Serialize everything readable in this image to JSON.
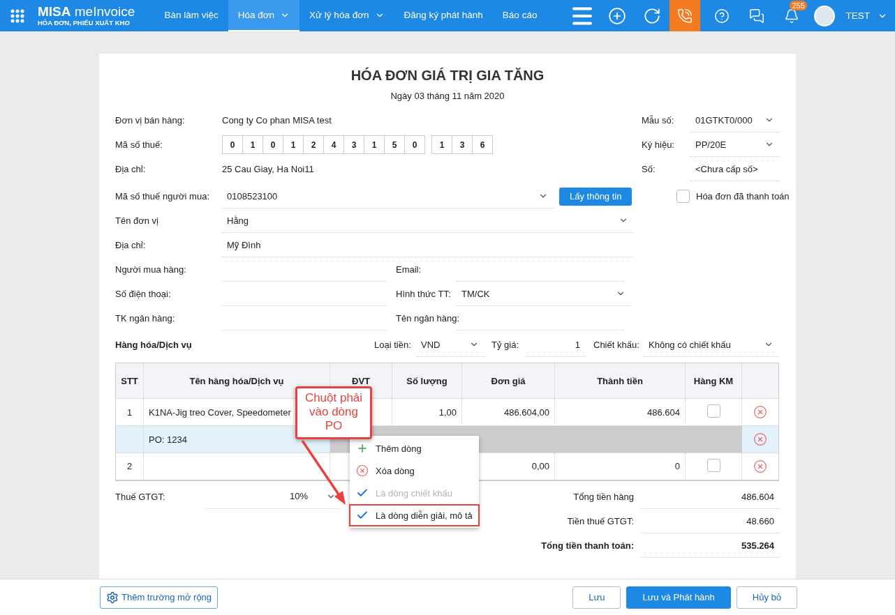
{
  "topbar": {
    "logo": {
      "brand": "MISA",
      "product": "meInvoice",
      "subtitle": "HÓA ĐƠN, PHIẾU XUẤT KHO"
    },
    "nav": [
      {
        "label": "Bàn làm việc",
        "selected": false,
        "dropdown": false
      },
      {
        "label": "Hóa đơn",
        "selected": true,
        "dropdown": true
      },
      {
        "label": "Xử lý hóa đơn",
        "selected": false,
        "dropdown": true
      },
      {
        "label": "Đăng ký phát hành",
        "selected": false,
        "dropdown": false
      },
      {
        "label": "Báo cáo",
        "selected": false,
        "dropdown": false
      }
    ],
    "tools": [
      {
        "kind": "menu",
        "highlighted": false
      },
      {
        "kind": "add",
        "highlighted": false
      },
      {
        "kind": "refresh",
        "highlighted": false
      },
      {
        "kind": "phone",
        "highlighted": true
      },
      {
        "kind": "help",
        "highlighted": false
      },
      {
        "kind": "chat",
        "highlighted": false
      },
      {
        "kind": "bell",
        "highlighted": false,
        "badge": "255"
      }
    ],
    "user": {
      "name": "TEST"
    }
  },
  "invoice": {
    "title": "HÓA ĐƠN GIÁ TRỊ GIA TĂNG",
    "date": "Ngày 03 tháng 11 năm 2020",
    "seller": [
      {
        "kind": "text",
        "label": "Đơn vị bán hàng:",
        "value": "Cong ty Co phan MISA test"
      },
      {
        "kind": "taxcode",
        "label": "Mã số thuế:",
        "groups": [
          [
            "0",
            "1",
            "0",
            "1",
            "2",
            "4",
            "3",
            "1",
            "5",
            "0"
          ],
          [
            "1",
            "3",
            "6"
          ]
        ]
      },
      {
        "kind": "text",
        "label": "Địa chỉ:",
        "value": "25 Cau Giay, Ha Noi11"
      }
    ],
    "meta": [
      {
        "label": "Mẫu số:",
        "value": "01GTKT0/000",
        "dropdown": true
      },
      {
        "label": "Ký hiệu:",
        "value": "PP/20E",
        "dropdown": true
      },
      {
        "label": "Số:",
        "value": "<Chưa cấp số>",
        "dropdown": false
      }
    ],
    "paid": {
      "label": "Hóa đơn đã thanh toán",
      "checked": false
    },
    "buyer": {
      "tax_code": {
        "label": "Mã số thuế người mua:",
        "value": "0108523100"
      },
      "lookup_button": "Lấy thông tin",
      "unit": {
        "label": "Tên đơn vị",
        "value": "Hằng"
      },
      "address": {
        "label": "Địa chỉ:",
        "value": "Mỹ Đình"
      },
      "buyer_name": {
        "label": "Người mua hàng:"
      },
      "email": {
        "label": "Email:"
      },
      "phone": {
        "label": "Số điện thoại:"
      },
      "payment": {
        "label": "Hình thức TT:",
        "value": "TM/CK"
      },
      "bank_account": {
        "label": "TK ngân hàng:"
      },
      "bank_name": {
        "label": "Tên ngân hàng:"
      }
    },
    "goods": {
      "title": "Hàng hóa/Dịch vụ",
      "currency": {
        "label": "Loại tiền:",
        "value": "VND"
      },
      "rate": {
        "label": "Tỷ giá:",
        "value": "1"
      },
      "discount": {
        "label": "Chiết khấu:",
        "value": "Không có chiết khấu"
      }
    },
    "table": {
      "columns": [
        "STT",
        "Tên hàng hóa/Dịch vụ",
        "ĐVT",
        "Số lượng",
        "Đơn giá",
        "Thành tiền",
        "Hàng KM"
      ],
      "rows": [
        {
          "kind": "item",
          "stt": "1",
          "name": "K1NA-Jig treo Cover, Speedometer",
          "quantity": "1,00",
          "unit_price": "486.604,00",
          "amount": "486.604",
          "promo": false,
          "selected": false
        },
        {
          "kind": "note",
          "name": "PO: 1234",
          "selected": true
        },
        {
          "kind": "item",
          "stt": "2",
          "unit_price": "0,00",
          "amount": "0",
          "promo": false,
          "selected": false
        }
      ]
    },
    "context_menu": [
      {
        "kind": "add",
        "label": "Thêm dòng",
        "disabled": false,
        "highlighted": false
      },
      {
        "kind": "delete",
        "label": "Xóa dòng",
        "disabled": false,
        "highlighted": false
      },
      {
        "kind": "check",
        "label": "Là dòng chiết khấu",
        "disabled": true,
        "highlighted": false
      },
      {
        "kind": "check",
        "label": "Là dòng diễn giải, mô tả",
        "disabled": false,
        "highlighted": true
      }
    ],
    "callout": "Chuột phải vào dòng PO",
    "vat": {
      "label": "Thuế GTGT:",
      "value": "10%"
    },
    "totals": [
      {
        "label": "Tổng tiền hàng",
        "value": "486.604",
        "bold": false
      },
      {
        "label": "Tiền thuế GTGT:",
        "value": "48.660",
        "bold": false
      },
      {
        "label": "Tổng tiền thanh toán:",
        "value": "535.264",
        "bold": true
      }
    ]
  },
  "footer": {
    "extend_button": "Thêm trường mở rộng",
    "buttons": [
      {
        "label": "Lưu",
        "kind": "secondary"
      },
      {
        "label": "Lưu và Phát hành",
        "kind": "primary"
      },
      {
        "label": "Hủy bỏ",
        "kind": "secondary"
      }
    ]
  }
}
